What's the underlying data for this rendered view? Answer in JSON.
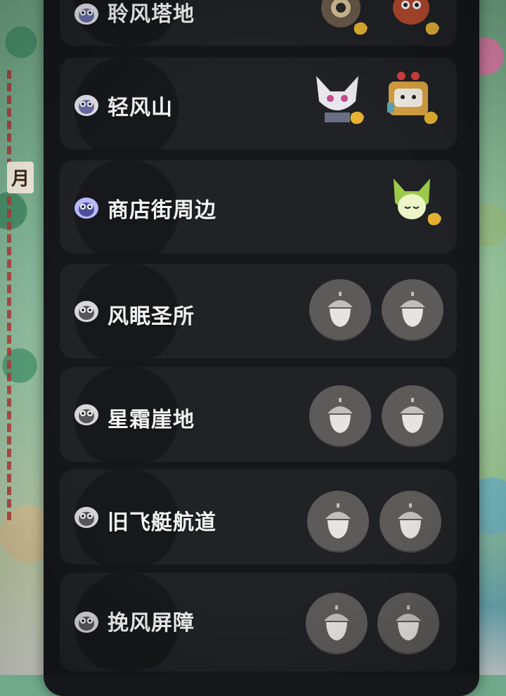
{
  "map": {
    "label": "月"
  },
  "locations": [
    {
      "name": "聆风塔地",
      "slots": [
        "creature-owl-mech",
        "creature-fire-bird"
      ]
    },
    {
      "name": "轻风山",
      "slots": [
        "creature-white-cat",
        "creature-box-robot"
      ]
    },
    {
      "name": "商店街周边",
      "slots": [
        "creature-green-cat"
      ]
    },
    {
      "name": "风眠圣所",
      "slots": [
        "acorn-icon",
        "acorn-icon"
      ]
    },
    {
      "name": "星霜崖地",
      "slots": [
        "acorn-icon",
        "acorn-icon"
      ]
    },
    {
      "name": "旧飞艇航道",
      "slots": [
        "acorn-icon",
        "acorn-icon"
      ]
    },
    {
      "name": "挽风屏障",
      "slots": [
        "acorn-icon",
        "acorn-icon"
      ]
    }
  ],
  "colors": {
    "panel": "#15171a",
    "row": "#202226",
    "acorn_button": "#5d5b5a",
    "text": "#f3f3f3"
  }
}
